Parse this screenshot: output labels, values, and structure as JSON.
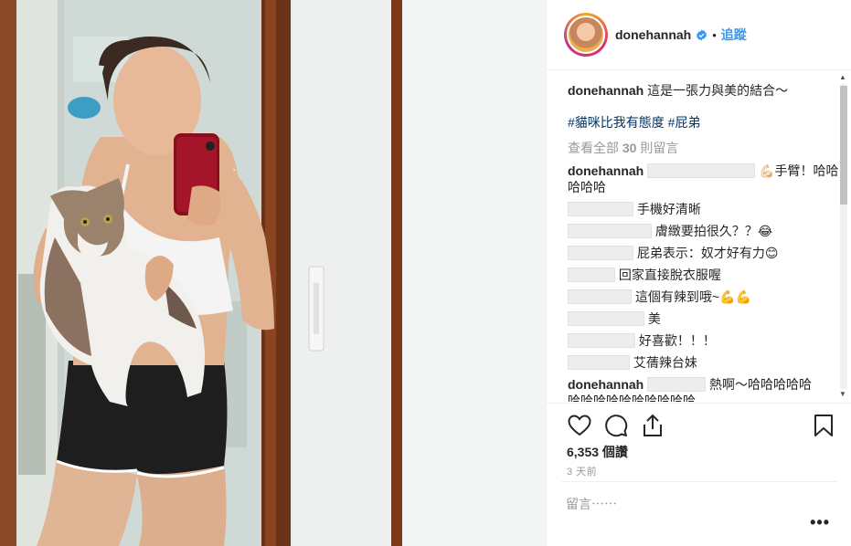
{
  "header": {
    "username": "donehannah",
    "follow_label": "追蹤",
    "separator": "•"
  },
  "caption": {
    "username": "donehannah",
    "text": "這是一張力與美的結合～",
    "hashtags": "#貓咪比我有態度 #屁弟"
  },
  "view_all_comments": {
    "prefix": "查看全部",
    "count": "30",
    "suffix": "則留言"
  },
  "comments": [
    {
      "user": "donehannah",
      "text": "💪🏻手臂！哈哈",
      "text2": "哈哈哈"
    },
    {
      "user": "",
      "text": "手機好清晰"
    },
    {
      "user": "",
      "text": "膚緻要拍很久？？😂"
    },
    {
      "user": "",
      "text": "屁弟表示：奴才好有力😊"
    },
    {
      "user": "",
      "text": "回家直接脫衣服喔"
    },
    {
      "user": "",
      "text": "這個有辣到哦~💪💪"
    },
    {
      "user": "",
      "text": "美"
    },
    {
      "user": "",
      "text": "好喜歡！！！"
    },
    {
      "user": "",
      "text": "艾蒨辣台妹"
    },
    {
      "user": "donehannah",
      "text": "熱啊～哈哈哈哈哈",
      "text2": "哈哈哈哈哈哈哈哈哈哈"
    }
  ],
  "stats": {
    "views": "6,353 個讚",
    "time": "3 天前"
  },
  "comment_input": {
    "placeholder": "留言⋯⋯"
  },
  "icons": {
    "like": "heart-icon",
    "comment": "comment-icon",
    "share": "share-icon",
    "save": "bookmark-icon",
    "verified": "verified-badge-icon",
    "more": "more-options-icon"
  },
  "colors": {
    "link": "#3897f0",
    "hashtag": "#003569",
    "muted": "#999999",
    "text": "#262626"
  }
}
